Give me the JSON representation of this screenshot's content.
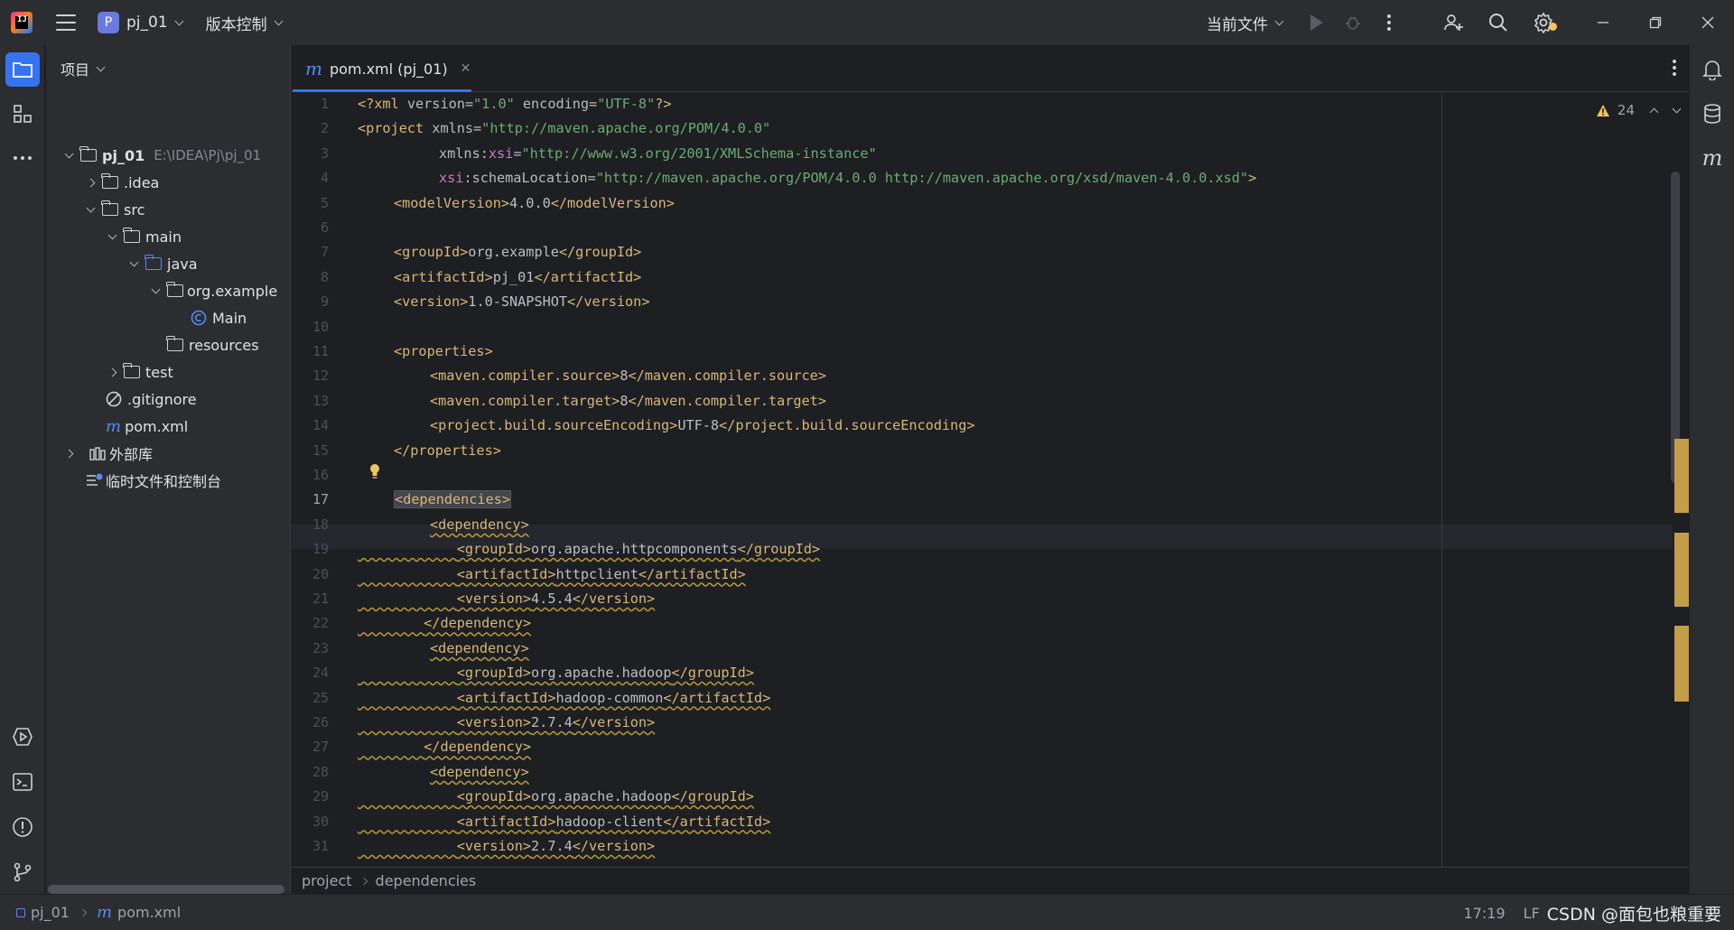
{
  "titlebar": {
    "project_badge": "P",
    "project_name": "pj_01",
    "vcs_menu": "版本控制",
    "run_config": "当前文件"
  },
  "project_panel": {
    "title": "项目",
    "tree": [
      {
        "label": "pj_01",
        "path": "E:\\IDEA\\Pj\\pj_01",
        "icon": "folder-icon"
      },
      {
        "label": ".idea",
        "icon": "folder-icon"
      },
      {
        "label": "src",
        "icon": "folder-icon"
      },
      {
        "label": "main",
        "icon": "folder-icon"
      },
      {
        "label": "java",
        "icon": "source-folder-icon"
      },
      {
        "label": "org.example",
        "icon": "package-icon"
      },
      {
        "label": "Main",
        "icon": "class-icon"
      },
      {
        "label": "resources",
        "icon": "resources-folder-icon"
      },
      {
        "label": "test",
        "icon": "folder-icon"
      },
      {
        "label": ".gitignore",
        "icon": "ignore-file-icon"
      },
      {
        "label": "pom.xml",
        "icon": "maven-icon"
      },
      {
        "label": "外部库",
        "icon": "library-icon"
      },
      {
        "label": "临时文件和控制台",
        "icon": "scratch-icon"
      }
    ]
  },
  "editor": {
    "tab_label": "pom.xml (pj_01)",
    "warnings_count": "24",
    "current_line": 17,
    "line_numbers": [
      "1",
      "2",
      "3",
      "4",
      "5",
      "6",
      "7",
      "8",
      "9",
      "10",
      "11",
      "12",
      "13",
      "14",
      "15",
      "16",
      "17",
      "18",
      "19",
      "20",
      "21",
      "22",
      "23",
      "24",
      "25",
      "26",
      "27",
      "28",
      "29",
      "30",
      "31"
    ],
    "code": {
      "l1": {
        "a": "<?xml ",
        "b": "version=",
        "c": "\"1.0\"",
        "d": " encoding=",
        "e": "\"UTF-8\"",
        "f": "?>"
      },
      "l2": {
        "a": "<project ",
        "b": "xmlns=",
        "c": "\"http://maven.apache.org/POM/4.0.0\""
      },
      "l3": {
        "a": "xmlns:",
        "b": "xsi",
        "c": "=",
        "d": "\"http://www.w3.org/2001/XMLSchema-instance\""
      },
      "l4": {
        "a": "xsi",
        "b": ":schemaLocation=",
        "c": "\"http://maven.apache.org/POM/4.0.0 http://maven.apache.org/xsd/maven-4.0.0.xsd\"",
        "d": ">"
      },
      "l5": {
        "a": "<modelVersion>",
        "b": "4.0.0",
        "c": "</modelVersion>"
      },
      "l7": {
        "a": "<groupId>",
        "b": "org.example",
        "c": "</groupId>"
      },
      "l8": {
        "a": "<artifactId>",
        "b": "pj_01",
        "c": "</artifactId>"
      },
      "l9": {
        "a": "<version>",
        "b": "1.0-SNAPSHOT",
        "c": "</version>"
      },
      "l11": {
        "a": "<properties>"
      },
      "l12": {
        "a": "<maven.compiler.source>",
        "b": "8",
        "c": "</maven.compiler.source>"
      },
      "l13": {
        "a": "<maven.compiler.target>",
        "b": "8",
        "c": "</maven.compiler.target>"
      },
      "l14": {
        "a": "<project.build.sourceEncoding>",
        "b": "UTF-8",
        "c": "</project.build.sourceEncoding>"
      },
      "l15": {
        "a": "</properties>"
      },
      "l17": {
        "a": "<dependencies>"
      },
      "l18": {
        "a": "<dependency>"
      },
      "l19": {
        "a": "<groupId>",
        "b": "org.apache.httpcomponents",
        "c": "</groupId>"
      },
      "l20": {
        "a": "<artifactId>",
        "b": "httpclient",
        "c": "</artifactId>"
      },
      "l21": {
        "a": "<version>",
        "b": "4.5.4",
        "c": "</version>"
      },
      "l22": {
        "a": "</dependency>"
      },
      "l23": {
        "a": "<dependency>"
      },
      "l24": {
        "a": "<groupId>",
        "b": "org.apache.hadoop",
        "c": "</groupId>"
      },
      "l25": {
        "a": "<artifactId>",
        "b": "hadoop-common",
        "c": "</artifactId>"
      },
      "l26": {
        "a": "<version>",
        "b": "2.7.4",
        "c": "</version>"
      },
      "l27": {
        "a": "</dependency>"
      },
      "l28": {
        "a": "<dependency>"
      },
      "l29": {
        "a": "<groupId>",
        "b": "org.apache.hadoop",
        "c": "</groupId>"
      },
      "l30": {
        "a": "<artifactId>",
        "b": "hadoop-client",
        "c": "</artifactId>"
      },
      "l31": {
        "a": "<version>",
        "b": "2.7.4",
        "c": "</version>"
      }
    },
    "breadcrumb": [
      "project",
      "dependencies"
    ]
  },
  "statusbar": {
    "project": "pj_01",
    "file": "pom.xml",
    "position": "17:19",
    "line_sep": "LF",
    "watermark": "CSDN @面包也粮重要"
  },
  "colors": {
    "accent": "#3574f0",
    "tag": "#d5b778",
    "string": "#6aab73",
    "namespace": "#c77dbb",
    "warning_mark": "#c29e48"
  }
}
